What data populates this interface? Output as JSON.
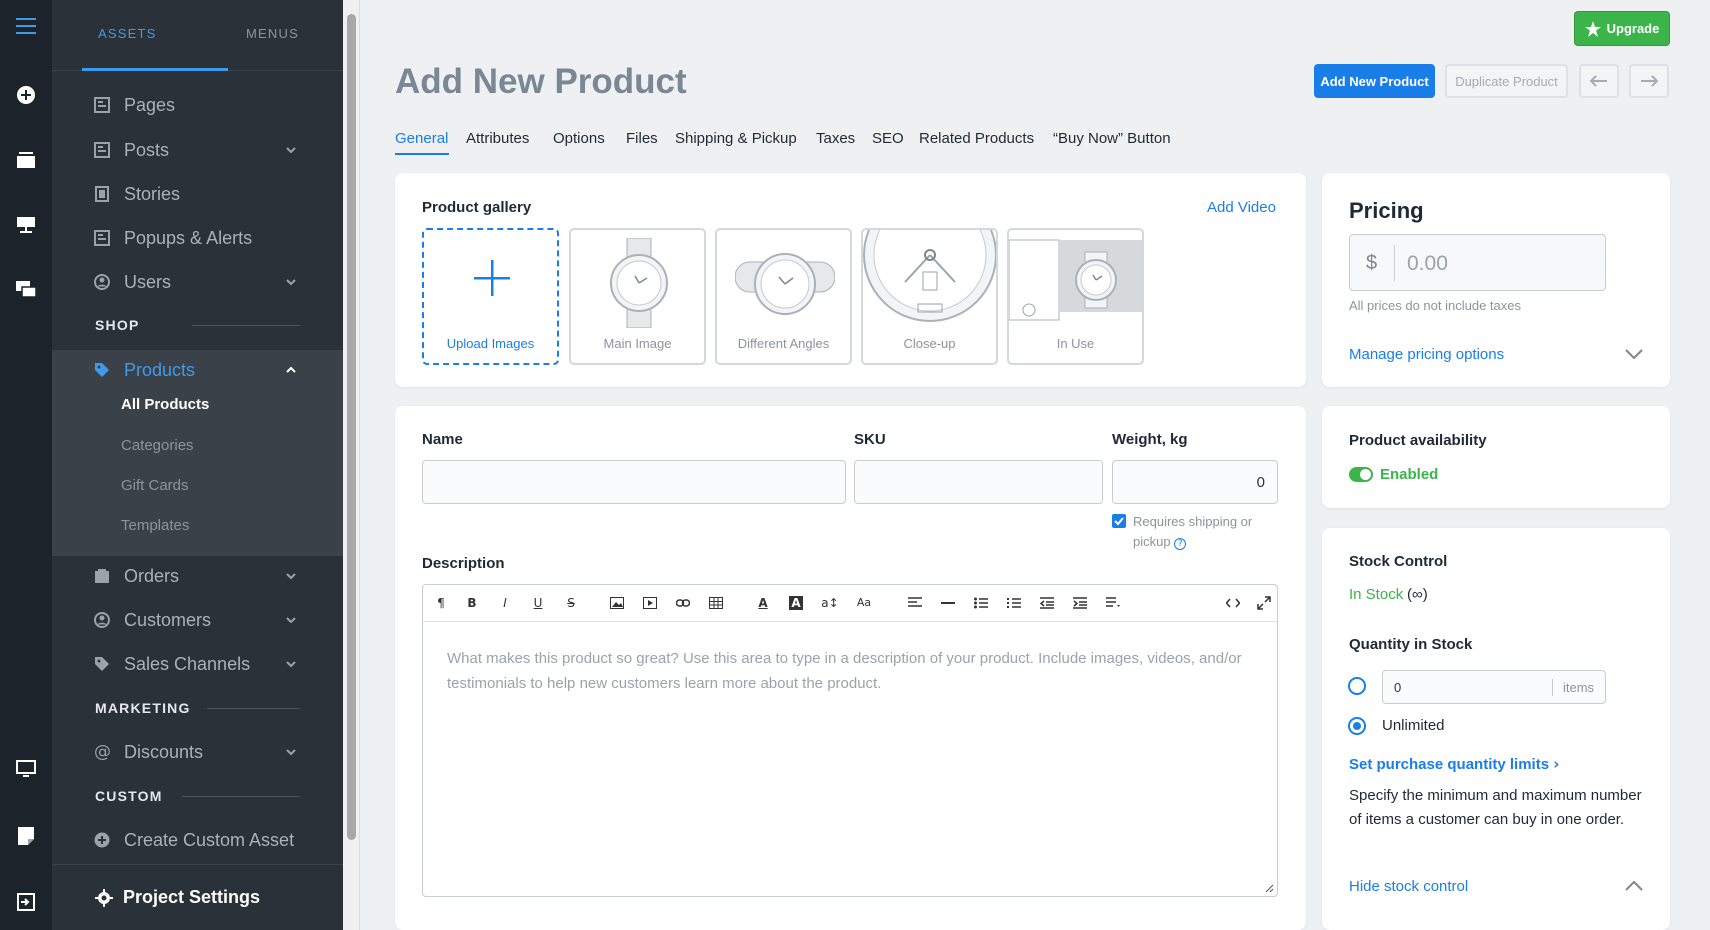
{
  "sidebar": {
    "tabs": [
      {
        "label": "ASSETS"
      },
      {
        "label": "MENUS"
      }
    ],
    "items": {
      "pages": "Pages",
      "posts": "Posts",
      "stories": "Stories",
      "popups": "Popups & Alerts",
      "users": "Users",
      "products": "Products",
      "orders": "Orders",
      "customers": "Customers",
      "sales_channels": "Sales Channels",
      "discounts": "Discounts",
      "custom_asset": "Create Custom Asset"
    },
    "sections": {
      "shop": "SHOP",
      "marketing": "MARKETING",
      "custom": "CUSTOM"
    },
    "products_sub": {
      "all": "All Products",
      "categories": "Categories",
      "gift_cards": "Gift Cards",
      "templates": "Templates"
    },
    "project_settings": "Project Settings"
  },
  "header": {
    "title": "Add New Product",
    "upgrade": "Upgrade",
    "add_new": "Add New Product",
    "duplicate": "Duplicate Product"
  },
  "tabs": [
    {
      "label": "General"
    },
    {
      "label": "Attributes"
    },
    {
      "label": "Options"
    },
    {
      "label": "Files"
    },
    {
      "label": "Shipping & Pickup"
    },
    {
      "label": "Taxes"
    },
    {
      "label": "SEO"
    },
    {
      "label": "Related Products"
    },
    {
      "label": "“Buy Now” Button"
    }
  ],
  "gallery": {
    "title": "Product gallery",
    "add_video": "Add Video",
    "thumbs": [
      "Upload Images",
      "Main Image",
      "Different Angles",
      "Close-up",
      "In Use"
    ]
  },
  "form": {
    "name_label": "Name",
    "sku_label": "SKU",
    "weight_label": "Weight, kg",
    "weight_value": "0",
    "requires_shipping": "Requires shipping or pickup",
    "description_label": "Description",
    "description_placeholder": "What makes this product so great? Use this area to type in a description of your product. Include images, videos, and/or testimonials to help new customers learn more about the product."
  },
  "pricing": {
    "title": "Pricing",
    "currency": "$",
    "placeholder": "0.00",
    "note": "All prices do not include taxes",
    "manage": "Manage pricing options"
  },
  "availability": {
    "title": "Product availability",
    "status": "Enabled"
  },
  "stock": {
    "title": "Stock Control",
    "status": "In Stock",
    "status_suffix": "(∞)",
    "qty_title": "Quantity in Stock",
    "qty_value": "0",
    "qty_unit": "items",
    "unlimited": "Unlimited",
    "limits_link": "Set purchase quantity limits",
    "limits_desc": "Specify the minimum and maximum number of items a customer can buy in one order.",
    "hide": "Hide stock control"
  },
  "colors": {
    "accent": "#1a7ee8",
    "success": "#3bb54a",
    "sidebar": "#2a3139"
  }
}
